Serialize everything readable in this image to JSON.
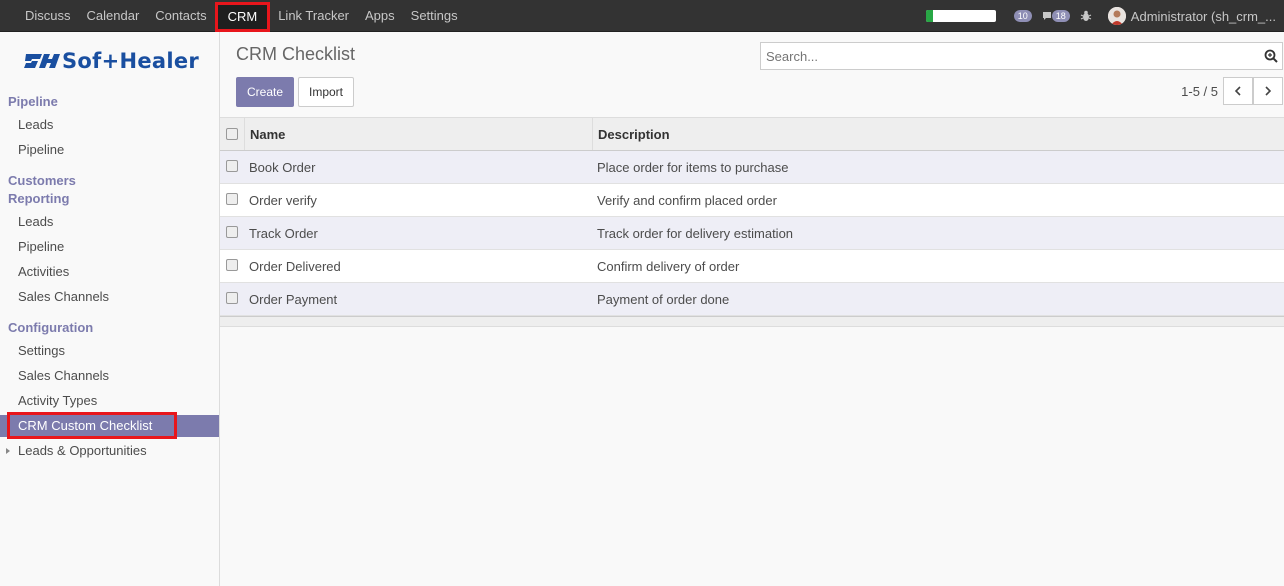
{
  "topbar": {
    "menu": [
      "Discuss",
      "Calendar",
      "Contacts",
      "CRM",
      "Link Tracker",
      "Apps",
      "Settings"
    ],
    "active_menu": "CRM",
    "progress": 0.1,
    "notification_count": "10",
    "message_count": "18",
    "user": "Administrator (sh_crm_..."
  },
  "sidebar": {
    "logo": "Sof+Healer",
    "sections": {
      "pipeline": "Pipeline",
      "customers": "Customers",
      "reporting": "Reporting",
      "configuration": "Configuration"
    },
    "items": {
      "leads_1": "Leads",
      "pipeline_1": "Pipeline",
      "leads_2": "Leads",
      "pipeline_2": "Pipeline",
      "activities": "Activities",
      "sales_channels_1": "Sales Channels",
      "settings": "Settings",
      "sales_channels_2": "Sales Channels",
      "activity_types": "Activity Types",
      "crm_custom_checklist": "CRM Custom Checklist",
      "leads_opportunities": "Leads & Opportunities"
    }
  },
  "main": {
    "title": "CRM Checklist",
    "search_placeholder": "Search...",
    "create_label": "Create",
    "import_label": "Import",
    "pager": "1-5 / 5"
  },
  "table": {
    "headers": {
      "name": "Name",
      "description": "Description"
    },
    "rows": [
      {
        "name": "Book Order",
        "description": "Place order for items to purchase"
      },
      {
        "name": "Order verify",
        "description": "Verify and confirm placed order"
      },
      {
        "name": "Track Order",
        "description": "Track order for delivery estimation"
      },
      {
        "name": "Order Delivered",
        "description": "Confirm delivery of order"
      },
      {
        "name": "Order Payment",
        "description": "Payment of order done"
      }
    ]
  }
}
